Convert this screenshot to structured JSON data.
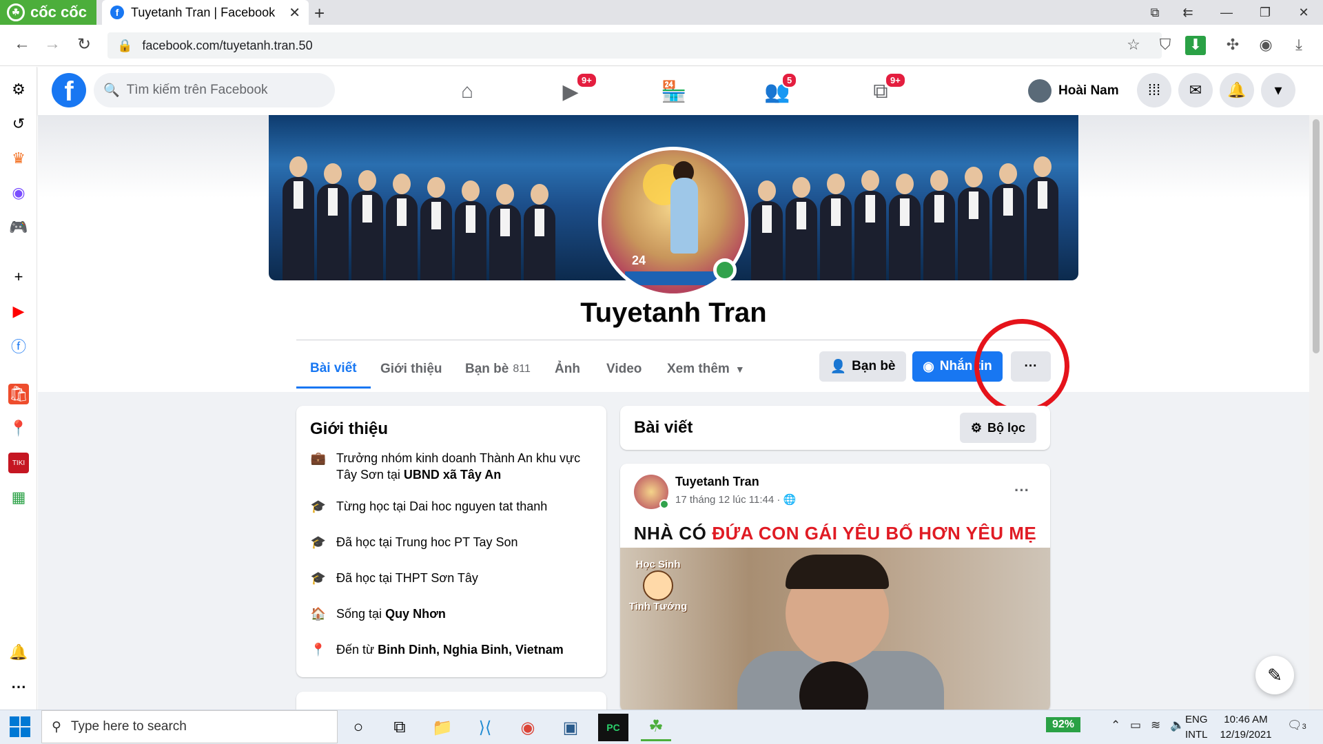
{
  "browser": {
    "brand": "cốc cốc",
    "tab_title": "Tuyetanh Tran | Facebook",
    "url": "facebook.com/tuyetanh.tran.50"
  },
  "fb": {
    "search_placeholder": "Tìm kiếm trên Facebook",
    "badges": {
      "watch": "9+",
      "groups": "5",
      "gaming": "9+"
    },
    "user_name": "Hoài Nam"
  },
  "profile": {
    "name": "Tuyetanh Tran",
    "tabs": [
      {
        "label": "Bài viết"
      },
      {
        "label": "Giới thiệu"
      },
      {
        "label": "Bạn bè",
        "count": "811"
      },
      {
        "label": "Ảnh"
      },
      {
        "label": "Video"
      },
      {
        "label": "Xem thêm"
      }
    ],
    "friends_button": "Bạn bè",
    "message_button": "Nhắn tin",
    "more_button": "···",
    "avatar_number": "24"
  },
  "intro": {
    "title": "Giới thiệu",
    "items": [
      {
        "icon": "briefcase-icon",
        "text": "Trưởng nhóm kinh doanh Thành An khu vực Tây Sơn tại ",
        "bold": "UBND xã Tây An"
      },
      {
        "icon": "graduation-cap-icon",
        "text": "Từng học tại Dai hoc nguyen tat thanh",
        "bold": ""
      },
      {
        "icon": "graduation-cap-icon",
        "text": "Đã học tại Trung hoc PT Tay Son",
        "bold": ""
      },
      {
        "icon": "graduation-cap-icon",
        "text": "Đã học tại THPT Sơn Tây",
        "bold": ""
      },
      {
        "icon": "home-icon",
        "text": "Sống tại ",
        "bold": "Quy Nhơn"
      },
      {
        "icon": "location-pin-icon",
        "text": "Đến từ ",
        "bold": "Binh Dinh, Nghia Binh, Vietnam"
      }
    ]
  },
  "posts": {
    "title": "Bài viết",
    "filter_label": "Bộ lọc",
    "post": {
      "author": "Tuyetanh Tran",
      "time": "17 tháng 12 lúc 11:44 · 🌐",
      "caption_black": "NHÀ CÓ",
      "caption_red": "ĐỨA CON GÁI YÊU BỐ HƠN YÊU MẸ",
      "sticker_top": "Học Sinh",
      "sticker_bottom": "Tinh Tướng"
    }
  },
  "taskbar": {
    "search_placeholder": "Type here to search",
    "battery": "92%",
    "lang_top": "ENG",
    "lang_bottom": "INTL",
    "time": "10:46 AM",
    "date": "12/19/2021",
    "notif_count": "3"
  },
  "colors": {
    "fb_blue": "#1877f2",
    "annotation_red": "#e5131b",
    "coccoc_green": "#4cae3b"
  }
}
